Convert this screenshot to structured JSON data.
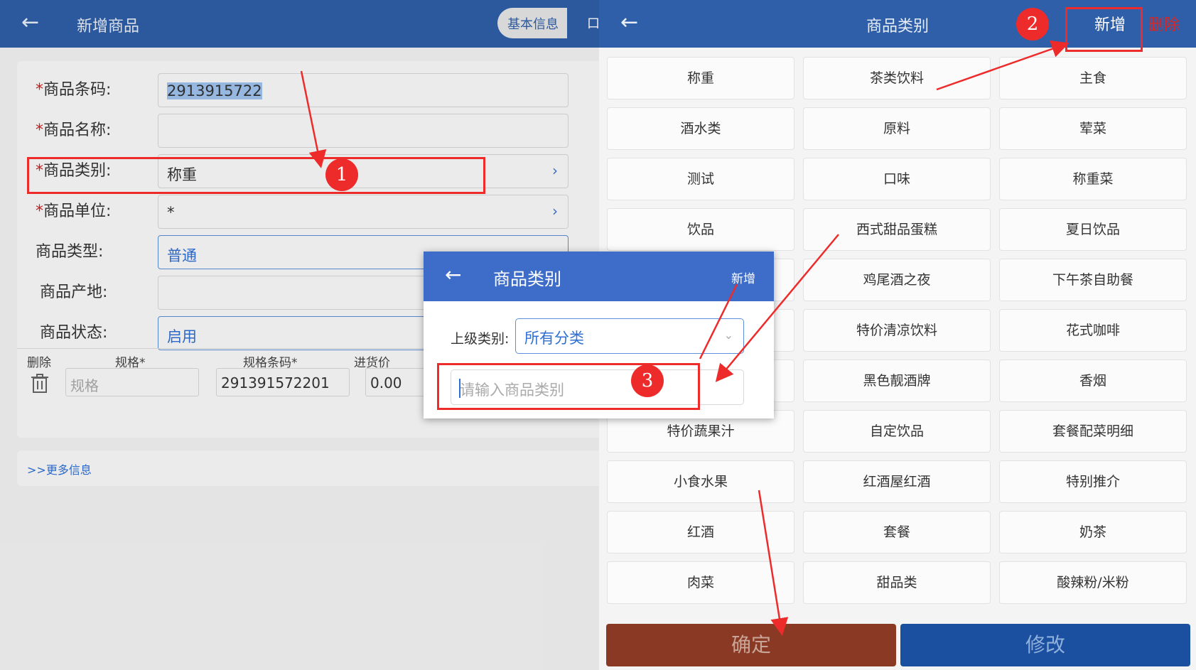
{
  "left_panel": {
    "title": "新增商品",
    "segment_basic": "基本信息",
    "segment_other": "口",
    "fields": {
      "barcode": {
        "label": "商品条码:",
        "value": "2913915722"
      },
      "name": {
        "label": "商品名称:",
        "value": ""
      },
      "category": {
        "label": "商品类别:",
        "value": "称重"
      },
      "unit": {
        "label": "商品单位:",
        "value": "*"
      },
      "type": {
        "label": "商品类型:",
        "value": "普通"
      },
      "origin": {
        "label": "商品产地:",
        "value": ""
      },
      "status": {
        "label": "商品状态:",
        "value": "启用"
      }
    },
    "required_mark": "*",
    "spec_table": {
      "headers": [
        "删除",
        "规格*",
        "规格条码*",
        "进货价"
      ],
      "spec_placeholder": "规格",
      "spec_barcode": "291391572201",
      "purchase_price": "0.00"
    },
    "more_info": ">>更多信息"
  },
  "right_panel": {
    "title": "商品类别",
    "add_label": "新增",
    "delete_label": "删除",
    "categories": [
      "称重",
      "茶类饮料",
      "主食",
      "酒水类",
      "原料",
      "荤菜",
      "测试",
      "口味",
      "称重菜",
      "饮品",
      "西式甜品蛋糕",
      "夏日饮品",
      "",
      "鸡尾酒之夜",
      "下午茶自助餐",
      "",
      "特价清凉饮料",
      "花式咖啡",
      "",
      "黑色靓酒牌",
      "香烟",
      "特价蔬果汁",
      "自定饮品",
      "套餐配菜明细",
      "小食水果",
      "红酒屋红酒",
      "特别推介",
      "红酒",
      "套餐",
      "奶茶",
      "肉菜",
      "甜品类",
      "酸辣粉/米粉"
    ],
    "confirm_label": "确定",
    "modify_label": "修改"
  },
  "dialog": {
    "title": "商品类别",
    "add_label": "新增",
    "parent_label": "上级类别:",
    "parent_value": "所有分类",
    "input_placeholder": "请输入商品类别"
  },
  "annotations": [
    "1",
    "2",
    "3"
  ],
  "colors": {
    "header_blue": "#2f5fa8",
    "dialog_blue": "#3d6cc9",
    "accent_red": "#ee2b2b",
    "confirm_bg": "#8a3a24",
    "modify_bg": "#1b4fa0"
  }
}
